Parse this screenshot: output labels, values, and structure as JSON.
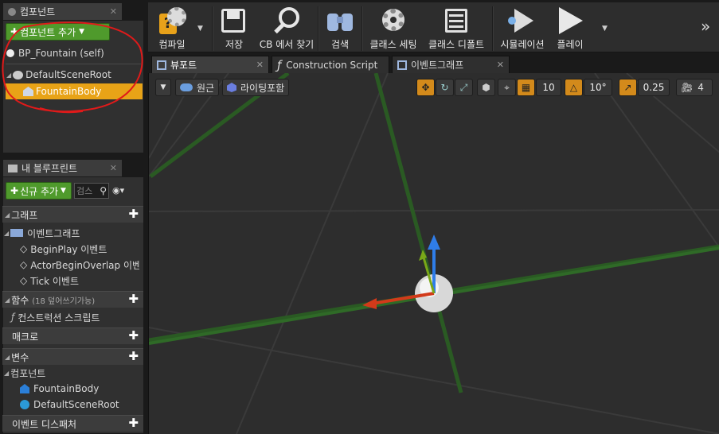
{
  "components_panel": {
    "tab_label": "컴포넌트",
    "add_button": "컴포넌트 추가",
    "self_item": "BP_Fountain (self)",
    "tree": [
      {
        "label": "DefaultSceneRoot"
      },
      {
        "label": "FountainBody"
      }
    ]
  },
  "blueprint_panel": {
    "tab_label": "내 블루프린트",
    "new_button": "신규 추가",
    "search_placeholder": "검스",
    "sections": {
      "graph": "그래프",
      "event_graph": "이벤트그래프",
      "events": [
        "BeginPlay 이벤트",
        "ActorBeginOverlap 이벤",
        "Tick 이벤트"
      ],
      "functions": "함수",
      "functions_note": "(18 덮어쓰기가능)",
      "construction_script": "컨스트럭션 스크립트",
      "macros": "매크로",
      "variables": "변수",
      "components": "컴포넌트",
      "component_vars": [
        "FountainBody",
        "DefaultSceneRoot"
      ],
      "dispatchers": "이벤트 디스패처"
    }
  },
  "toolbar": {
    "compile": "컴파일",
    "save": "저장",
    "find_in_cb": "CB 에서 찾기",
    "search": "검색",
    "class_settings": "클래스 세팅",
    "class_defaults": "클래스 디폴트",
    "simulation": "시뮬레이션",
    "play": "플레이",
    "more": "»"
  },
  "doc_tabs": {
    "viewport": "뷰포트",
    "construction": "Construction Script",
    "event_graph": "이벤트그래프"
  },
  "viewport": {
    "perspective": "원근",
    "lighting": "라이팅포함",
    "grid_snap": "10",
    "rot_snap": "10°",
    "scale_snap": "0.25",
    "camera_speed": "4"
  },
  "colors": {
    "accent_green": "#4f9a2c",
    "selected_row": "#e8a317",
    "annotation_red": "#e01a1a",
    "snap_orange": "#d38a1b"
  }
}
